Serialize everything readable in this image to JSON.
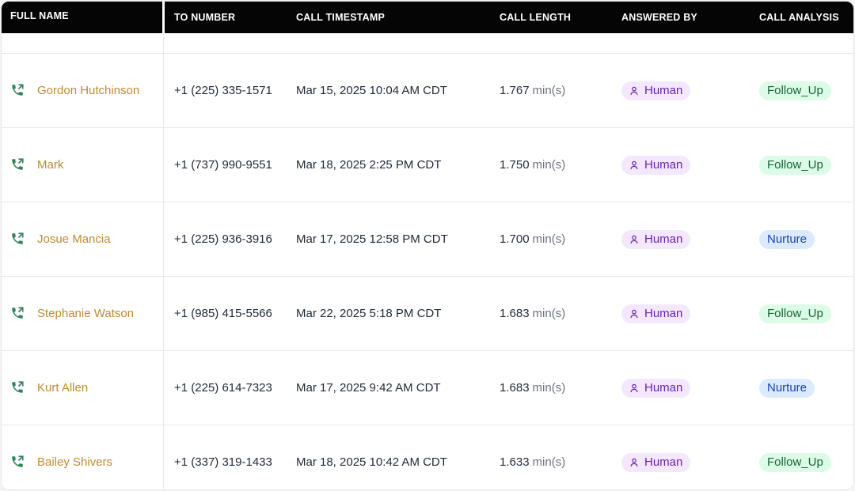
{
  "columns": {
    "full_name": "FULL NAME",
    "to_number": "TO NUMBER",
    "call_timestamp": "CALL TIMESTAMP",
    "call_length": "CALL LENGTH",
    "answered_by": "ANSWERED BY",
    "call_analysis": "CALL ANALYSIS"
  },
  "length_unit": "min(s)",
  "icons": {
    "phone": "phone-outgoing-icon",
    "person": "person-icon"
  },
  "colors": {
    "name": "#c08a33",
    "phone_icon": "#2f855a",
    "human_bg": "#f3e8ff",
    "human_text": "#6b21a8",
    "follow_up_bg": "#dcfce7",
    "follow_up_text": "#166534",
    "nurture_bg": "#dbeafe",
    "nurture_text": "#1e40af"
  },
  "rows": [
    {
      "full_name": "Gordon Hutchinson",
      "to_number": "+1 (225) 335-1571",
      "call_timestamp": "Mar 15, 2025 10:04 AM CDT",
      "call_length": "1.767",
      "answered_by": "Human",
      "call_analysis": "Follow_Up"
    },
    {
      "full_name": "Mark",
      "to_number": "+1 (737) 990-9551",
      "call_timestamp": "Mar 18, 2025 2:25 PM CDT",
      "call_length": "1.750",
      "answered_by": "Human",
      "call_analysis": "Follow_Up"
    },
    {
      "full_name": "Josue Mancia",
      "to_number": "+1 (225) 936-3916",
      "call_timestamp": "Mar 17, 2025 12:58 PM CDT",
      "call_length": "1.700",
      "answered_by": "Human",
      "call_analysis": "Nurture"
    },
    {
      "full_name": "Stephanie Watson",
      "to_number": "+1 (985) 415-5566",
      "call_timestamp": "Mar 22, 2025 5:18 PM CDT",
      "call_length": "1.683",
      "answered_by": "Human",
      "call_analysis": "Follow_Up"
    },
    {
      "full_name": "Kurt Allen",
      "to_number": "+1 (225) 614-7323",
      "call_timestamp": "Mar 17, 2025 9:42 AM CDT",
      "call_length": "1.683",
      "answered_by": "Human",
      "call_analysis": "Nurture"
    },
    {
      "full_name": "Bailey Shivers",
      "to_number": "+1 (337) 319-1433",
      "call_timestamp": "Mar 18, 2025 10:42 AM CDT",
      "call_length": "1.633",
      "answered_by": "Human",
      "call_analysis": "Follow_Up"
    }
  ]
}
